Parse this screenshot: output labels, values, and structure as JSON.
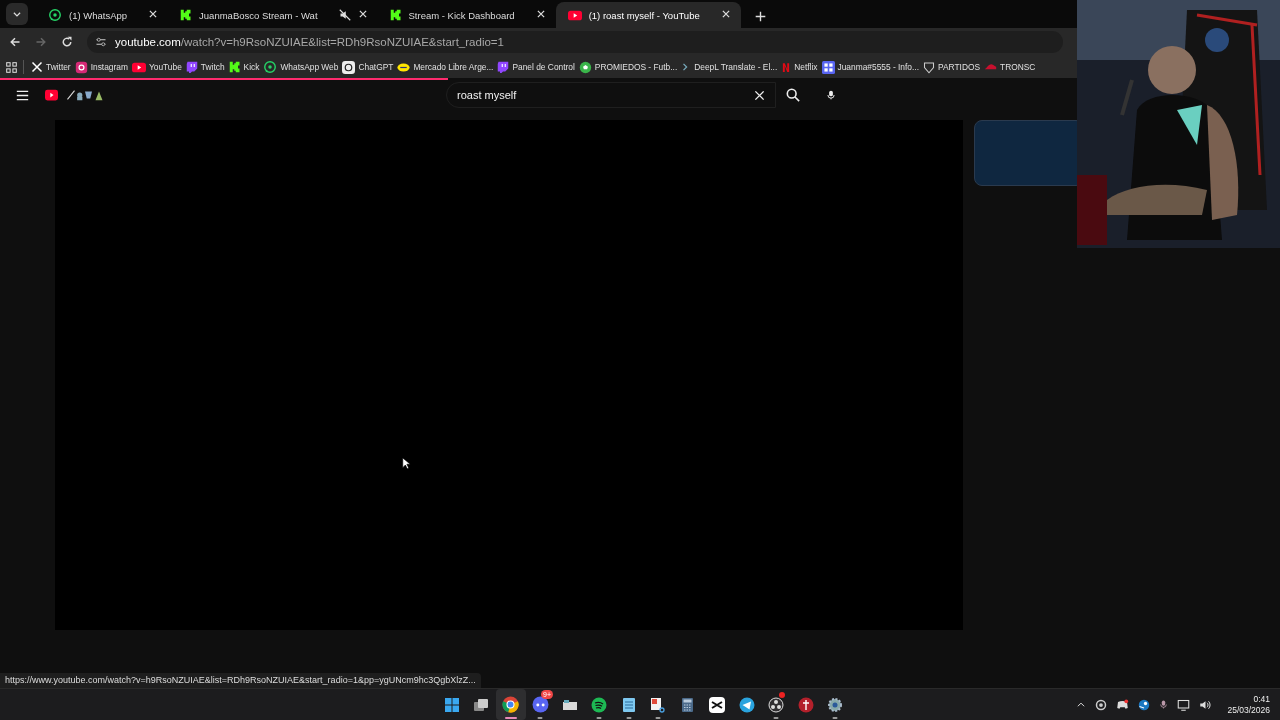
{
  "tabs": [
    {
      "title": "(1) WhatsApp",
      "kind": "whatsapp",
      "selected": false,
      "muted": false
    },
    {
      "title": "JuanmaBosco Stream - Wat",
      "kind": "kick",
      "selected": false,
      "muted": true
    },
    {
      "title": "Stream - Kick Dashboard",
      "kind": "kick",
      "selected": false,
      "muted": false
    },
    {
      "title": "(1) roast myself - YouTube",
      "kind": "youtube",
      "selected": true,
      "muted": false
    }
  ],
  "address_bar": {
    "host": "youtube.com",
    "path": "/watch?v=h9RsoNZUIAE&list=RDh9RsoNZUIAE&start_radio=1"
  },
  "bookmarks": [
    {
      "label": "Twitter",
      "kind": "x"
    },
    {
      "label": "Instagram",
      "kind": "instagram"
    },
    {
      "label": "YouTube",
      "kind": "youtube"
    },
    {
      "label": "Twitch",
      "kind": "twitch"
    },
    {
      "label": "Kick",
      "kind": "kick"
    },
    {
      "label": "WhatsApp Web",
      "kind": "whatsapp"
    },
    {
      "label": "ChatGPT",
      "kind": "chatgpt"
    },
    {
      "label": "Mercado Libre Arge...",
      "kind": "mercado"
    },
    {
      "label": "Panel de Control",
      "kind": "twitch"
    },
    {
      "label": "PROMIEDOS - Futb...",
      "kind": "ball"
    },
    {
      "label": "DeepL Translate - El...",
      "kind": "deepl"
    },
    {
      "label": "Netflix",
      "kind": "netflix"
    },
    {
      "label": "Juanma#5555 - Info...",
      "kind": "grid"
    },
    {
      "label": "PARTIDOS",
      "kind": "shield"
    },
    {
      "label": "TRONSC",
      "kind": "hat"
    }
  ],
  "page_load": {
    "level": 0.35
  },
  "youtube": {
    "search_value": "roast myself"
  },
  "status_url": "https://www.youtube.com/watch?v=h9RsoNZUIAE&list=RDh9RsoNZUIAE&start_radio=1&pp=ygUNcm9hc3QgbXlzZ...",
  "taskbar": {
    "apps": [
      {
        "kind": "start",
        "active": false,
        "running": false
      },
      {
        "kind": "taskview",
        "active": false,
        "running": false
      },
      {
        "kind": "chrome",
        "active": true,
        "running": true
      },
      {
        "kind": "discord",
        "active": false,
        "running": true,
        "badge": "9+"
      },
      {
        "kind": "files",
        "active": false,
        "running": false
      },
      {
        "kind": "spotify",
        "active": false,
        "running": true
      },
      {
        "kind": "notepad",
        "active": false,
        "running": true
      },
      {
        "kind": "snip",
        "active": false,
        "running": true
      },
      {
        "kind": "calculator",
        "active": false,
        "running": false
      },
      {
        "kind": "capcut",
        "active": false,
        "running": false
      },
      {
        "kind": "telegram",
        "active": false,
        "running": false
      },
      {
        "kind": "obs",
        "active": false,
        "running": true,
        "alert": true
      },
      {
        "kind": "redapp",
        "active": false,
        "running": false
      },
      {
        "kind": "settings",
        "active": false,
        "running": true
      }
    ],
    "tray": [
      {
        "kind": "chevron"
      },
      {
        "kind": "ring"
      },
      {
        "kind": "discord",
        "alert": true
      },
      {
        "kind": "steam"
      },
      {
        "kind": "mic"
      },
      {
        "kind": "monitor"
      },
      {
        "kind": "speaker"
      }
    ],
    "time": "0:41",
    "date": "25/03/2026"
  }
}
